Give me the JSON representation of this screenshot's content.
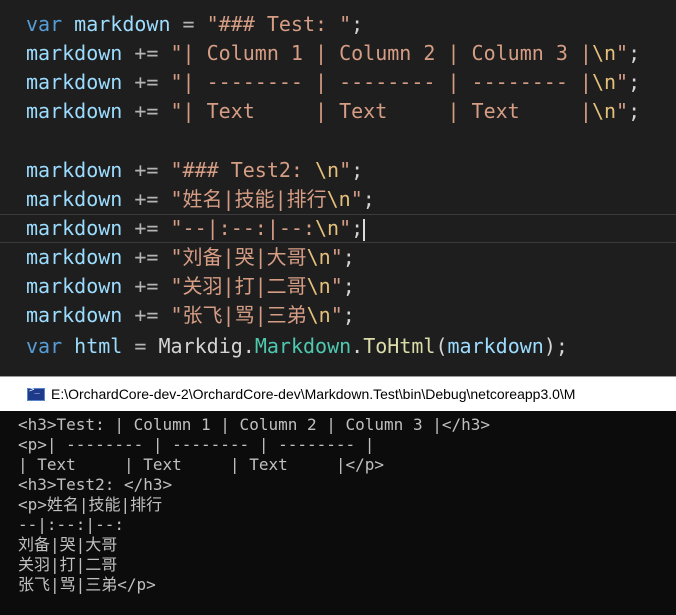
{
  "editor": {
    "line1": {
      "kw": "var",
      "name": "markdown",
      "op": "=",
      "str": "\"### Test: \"",
      "end": ";"
    },
    "line2": {
      "name": "markdown",
      "op": "+=",
      "str": "\"| Column 1 | Column 2 | Column 3 |",
      "esc": "\\n",
      "strEnd": "\"",
      "end": ";"
    },
    "line3": {
      "name": "markdown",
      "op": "+=",
      "str": "\"| -------- | -------- | -------- |",
      "esc": "\\n",
      "strEnd": "\"",
      "end": ";"
    },
    "line4": {
      "name": "markdown",
      "op": "+=",
      "str": "\"| Text     | Text     | Text     |",
      "esc": "\\n",
      "strEnd": "\"",
      "end": ";"
    },
    "line5": {
      "name": "markdown",
      "op": "+=",
      "str": "\"### Test2: ",
      "esc": "\\n",
      "strEnd": "\"",
      "end": ";"
    },
    "line6": {
      "name": "markdown",
      "op": "+=",
      "str": "\"姓名|技能|排行",
      "esc": "\\n",
      "strEnd": "\"",
      "end": ";"
    },
    "line7": {
      "name": "markdown",
      "op": "+=",
      "str": "\"--|:--:|--:",
      "esc": "\\n",
      "strEnd": "\"",
      "end": ";"
    },
    "line8": {
      "name": "markdown",
      "op": "+=",
      "str": "\"刘备|哭|大哥",
      "esc": "\\n",
      "strEnd": "\"",
      "end": ";"
    },
    "line9": {
      "name": "markdown",
      "op": "+=",
      "str": "\"关羽|打|二哥",
      "esc": "\\n",
      "strEnd": "\"",
      "end": ";"
    },
    "line10": {
      "name": "markdown",
      "op": "+=",
      "str": "\"张飞|骂|三弟",
      "esc": "\\n",
      "strEnd": "\"",
      "end": ";"
    },
    "line11": {
      "kw": "var",
      "name": "html",
      "op": "=",
      "cls1": "Markdig",
      "dot1": ".",
      "cls2": "Markdown",
      "dot2": ".",
      "method": "ToHtml",
      "paren1": "(",
      "arg": "markdown",
      "paren2": ")",
      "end": ";"
    }
  },
  "console": {
    "title": "E:\\OrchardCore-dev-2\\OrchardCore-dev\\Markdown.Test\\bin\\Debug\\netcoreapp3.0\\M",
    "icon": "console-app-icon",
    "lines": [
      "<h3>Test: | Column 1 | Column 2 | Column 3 |</h3>",
      "<p>| -------- | -------- | -------- |",
      "| Text     | Text     | Text     |</p>",
      "<h3>Test2: </h3>",
      "<p>姓名|技能|排行",
      "--|:--:|--:",
      "刘备|哭|大哥",
      "关羽|打|二哥",
      "张飞|骂|三弟</p>"
    ]
  }
}
